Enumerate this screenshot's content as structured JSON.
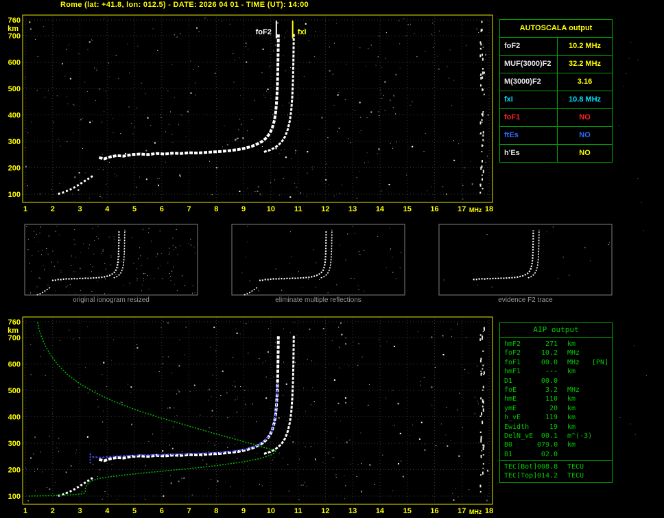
{
  "title": "Rome (lat: +41.8, lon: 012.5) - DATE: 2026 04 01 - TIME (UT): 14:00",
  "colors": {
    "frame": "#e8e800",
    "grid": "#3c3c3c",
    "axis_text": "#ffff00",
    "thumb_border": "#808080",
    "caption_text": "#9a9a9a",
    "table_border": "#00a800",
    "aip_text": "#00cc00",
    "trace_white": "#ffffff",
    "trace_blue": "#4444ff",
    "profile_green": "#00bb00"
  },
  "autoscala": {
    "header": "AUTOSCALA output",
    "rows": [
      {
        "label": "foF2",
        "value": "10.2 MHz",
        "label_color": "#e8e8e8",
        "value_color": "#ffff00"
      },
      {
        "label": "MUF(3000)F2",
        "value": "32.2 MHz",
        "label_color": "#e8e8e8",
        "value_color": "#ffff00"
      },
      {
        "label": "M(3000)F2",
        "value": "3.16",
        "label_color": "#e8e8e8",
        "value_color": "#ffff00"
      },
      {
        "label": "fxI",
        "value": "10.8 MHz",
        "label_color": "#00e0ff",
        "value_color": "#00e0ff"
      },
      {
        "label": "foF1",
        "value": "NO",
        "label_color": "#ff2020",
        "value_color": "#ff2020"
      },
      {
        "label": "ftEs",
        "value": "NO",
        "label_color": "#2f6bff",
        "value_color": "#2f6bff"
      },
      {
        "label": "h'Es",
        "value": "NO",
        "label_color": "#e8e8e8",
        "value_color": "#ffff00"
      }
    ]
  },
  "thumbnails": [
    {
      "caption": "original ionogram resized"
    },
    {
      "caption": "eliminate multiple reflections"
    },
    {
      "caption": "evidence F2 trace"
    }
  ],
  "aip": {
    "header": "AIP output",
    "rows": [
      {
        "name": "hmF2",
        "value": "271",
        "unit": "km",
        "note": ""
      },
      {
        "name": "foF2",
        "value": "10.2",
        "unit": "MHz",
        "note": ""
      },
      {
        "name": "foF1",
        "value": "00.0",
        "unit": "MHz",
        "note": "[PN]"
      },
      {
        "name": "hmF1",
        "value": "---",
        "unit": "km",
        "note": ""
      },
      {
        "name": "D1",
        "value": "00.0",
        "unit": "",
        "note": ""
      },
      {
        "name": "foE",
        "value": "3.2",
        "unit": "MHz",
        "note": ""
      },
      {
        "name": "hmE",
        "value": "110",
        "unit": "km",
        "note": ""
      },
      {
        "name": "ymE",
        "value": "20",
        "unit": "km",
        "note": ""
      },
      {
        "name": "h_vE",
        "value": "119",
        "unit": "km",
        "note": ""
      },
      {
        "name": "Ewidth",
        "value": "19",
        "unit": "km",
        "note": ""
      },
      {
        "name": "DelN_vE",
        "value": "00.1",
        "unit": "m^(-3)",
        "note": ""
      },
      {
        "name": "B0",
        "value": "079.0",
        "unit": "km",
        "note": ""
      },
      {
        "name": "B1",
        "value": "02.0",
        "unit": "",
        "note": ""
      }
    ],
    "tec_rows": [
      {
        "name": "TEC[Bot]",
        "value": "008.8",
        "unit": "TECU"
      },
      {
        "name": "TEC[Top]",
        "value": "014.2",
        "unit": "TECU"
      }
    ]
  },
  "chart_data": [
    {
      "id": "ionogram-top",
      "type": "scatter",
      "title": "recorded ionogram",
      "xlabel": "MHz",
      "ylabel": "km",
      "xlim": [
        1,
        18
      ],
      "ylim": [
        100,
        760
      ],
      "x_ticks": [
        1,
        2,
        3,
        4,
        5,
        6,
        7,
        8,
        9,
        10,
        11,
        12,
        13,
        14,
        15,
        16,
        17,
        18
      ],
      "y_ticks": [
        100,
        200,
        300,
        400,
        500,
        600,
        700,
        760
      ],
      "grid": true,
      "annotations": [
        {
          "label": "foF2",
          "x_mhz": 10.2,
          "color": "#ffffff",
          "label_anchor": "end"
        },
        {
          "label": "fxI",
          "x_mhz": 10.8,
          "color": "#ffff00",
          "label_anchor": "start"
        }
      ],
      "series": [
        {
          "name": "E-region-multiple-trace",
          "color": "#ffffff",
          "width": 3,
          "dash": "3 3",
          "points": [
            [
              2.2,
              101
            ],
            [
              2.35,
              105
            ],
            [
              2.5,
              111
            ],
            [
              2.65,
              118
            ],
            [
              2.8,
              126
            ],
            [
              2.95,
              135
            ],
            [
              3.1,
              145
            ],
            [
              3.25,
              155
            ],
            [
              3.4,
              164
            ],
            [
              3.5,
              172
            ]
          ]
        },
        {
          "name": "F2-O-trace",
          "color": "#ffffff",
          "width": 4,
          "dash": "5 2",
          "points": [
            [
              3.7,
              238
            ],
            [
              3.9,
              234
            ],
            [
              4.1,
              241
            ],
            [
              4.35,
              246
            ],
            [
              4.6,
              244
            ],
            [
              4.9,
              250
            ],
            [
              5.2,
              252
            ],
            [
              5.5,
              250
            ],
            [
              5.8,
              254
            ],
            [
              6.1,
              252
            ],
            [
              6.4,
              255
            ],
            [
              6.7,
              254
            ],
            [
              7.0,
              257
            ],
            [
              7.3,
              256
            ],
            [
              7.6,
              258
            ],
            [
              7.9,
              260
            ],
            [
              8.2,
              262
            ],
            [
              8.5,
              265
            ],
            [
              8.8,
              269
            ],
            [
              9.05,
              274
            ],
            [
              9.3,
              281
            ],
            [
              9.5,
              290
            ],
            [
              9.7,
              301
            ],
            [
              9.85,
              315
            ],
            [
              9.97,
              332
            ],
            [
              10.06,
              354
            ],
            [
              10.13,
              380
            ],
            [
              10.18,
              412
            ],
            [
              10.21,
              450
            ],
            [
              10.235,
              495
            ],
            [
              10.25,
              545
            ],
            [
              10.26,
              600
            ],
            [
              10.27,
              660
            ],
            [
              10.275,
              705
            ]
          ]
        },
        {
          "name": "F2-X-trace",
          "color": "#ffffff",
          "width": 3,
          "dash": "4 2",
          "points": [
            [
              9.75,
              260
            ],
            [
              10.0,
              268
            ],
            [
              10.2,
              280
            ],
            [
              10.38,
              296
            ],
            [
              10.52,
              318
            ],
            [
              10.62,
              345
            ],
            [
              10.7,
              380
            ],
            [
              10.75,
              420
            ],
            [
              10.785,
              470
            ],
            [
              10.81,
              530
            ],
            [
              10.825,
              600
            ],
            [
              10.835,
              670
            ],
            [
              10.84,
              710
            ]
          ]
        }
      ]
    },
    {
      "id": "ionogram-bottom",
      "type": "scatter",
      "title": "autoscaled ionogram with restored trace and electron density profile",
      "xlabel": "MHz",
      "ylabel": "km",
      "xlim": [
        1,
        18
      ],
      "ylim": [
        100,
        760
      ],
      "x_ticks": [
        1,
        2,
        3,
        4,
        5,
        6,
        7,
        8,
        9,
        10,
        11,
        12,
        13,
        14,
        15,
        16,
        17,
        18
      ],
      "y_ticks": [
        100,
        200,
        300,
        400,
        500,
        600,
        700,
        760
      ],
      "grid": true,
      "annotations": [],
      "series": [
        {
          "name": "E-region-multiple-trace",
          "color": "#ffffff",
          "width": 3,
          "dash": "3 3",
          "points": [
            [
              2.2,
              101
            ],
            [
              2.35,
              105
            ],
            [
              2.5,
              111
            ],
            [
              2.65,
              118
            ],
            [
              2.8,
              126
            ],
            [
              2.95,
              135
            ],
            [
              3.1,
              145
            ],
            [
              3.25,
              155
            ],
            [
              3.4,
              164
            ],
            [
              3.5,
              172
            ]
          ]
        },
        {
          "name": "F2-O-trace",
          "color": "#ffffff",
          "width": 4,
          "dash": "5 2",
          "points": [
            [
              3.7,
              238
            ],
            [
              3.9,
              234
            ],
            [
              4.1,
              241
            ],
            [
              4.35,
              246
            ],
            [
              4.6,
              244
            ],
            [
              4.9,
              250
            ],
            [
              5.2,
              252
            ],
            [
              5.5,
              250
            ],
            [
              5.8,
              254
            ],
            [
              6.1,
              252
            ],
            [
              6.4,
              255
            ],
            [
              6.7,
              254
            ],
            [
              7.0,
              257
            ],
            [
              7.3,
              256
            ],
            [
              7.6,
              258
            ],
            [
              7.9,
              260
            ],
            [
              8.2,
              262
            ],
            [
              8.5,
              265
            ],
            [
              8.8,
              269
            ],
            [
              9.05,
              274
            ],
            [
              9.3,
              281
            ],
            [
              9.5,
              290
            ],
            [
              9.7,
              301
            ],
            [
              9.85,
              315
            ],
            [
              9.97,
              332
            ],
            [
              10.06,
              354
            ],
            [
              10.13,
              380
            ],
            [
              10.18,
              412
            ],
            [
              10.21,
              450
            ],
            [
              10.235,
              495
            ],
            [
              10.25,
              545
            ],
            [
              10.26,
              600
            ],
            [
              10.27,
              660
            ],
            [
              10.275,
              705
            ]
          ]
        },
        {
          "name": "F2-X-trace",
          "color": "#ffffff",
          "width": 3,
          "dash": "4 2",
          "points": [
            [
              9.75,
              260
            ],
            [
              10.0,
              268
            ],
            [
              10.2,
              280
            ],
            [
              10.38,
              296
            ],
            [
              10.52,
              318
            ],
            [
              10.62,
              345
            ],
            [
              10.7,
              380
            ],
            [
              10.75,
              420
            ],
            [
              10.785,
              470
            ],
            [
              10.81,
              530
            ],
            [
              10.825,
              600
            ],
            [
              10.835,
              670
            ],
            [
              10.84,
              710
            ]
          ]
        },
        {
          "name": "restored-trace-start-marker",
          "color": "#5555ff",
          "width": 2,
          "dash": "2 2",
          "points": [
            [
              3.38,
              224
            ],
            [
              3.38,
              266
            ]
          ]
        },
        {
          "name": "autoscala-restored-trace",
          "color": "#4444ff",
          "width": 2,
          "dash": "3 2",
          "points": [
            [
              3.45,
              248
            ],
            [
              3.8,
              246
            ],
            [
              4.2,
              250
            ],
            [
              4.7,
              253
            ],
            [
              5.2,
              255
            ],
            [
              5.7,
              256
            ],
            [
              6.2,
              258
            ],
            [
              6.7,
              259
            ],
            [
              7.2,
              261
            ],
            [
              7.7,
              263
            ],
            [
              8.2,
              266
            ],
            [
              8.6,
              270
            ],
            [
              9.0,
              276
            ],
            [
              9.3,
              284
            ],
            [
              9.55,
              294
            ],
            [
              9.75,
              307
            ],
            [
              9.9,
              323
            ],
            [
              10.02,
              344
            ],
            [
              10.1,
              370
            ],
            [
              10.16,
              402
            ],
            [
              10.2,
              440
            ],
            [
              10.23,
              485
            ],
            [
              10.25,
              530
            ]
          ]
        },
        {
          "name": "electron-density-profile",
          "color": "#00bb00",
          "width": 1.5,
          "dash": "2 2",
          "points": [
            [
              1.45,
              758
            ],
            [
              1.5,
              730
            ],
            [
              1.6,
              700
            ],
            [
              1.75,
              665
            ],
            [
              1.95,
              630
            ],
            [
              2.2,
              596
            ],
            [
              2.55,
              560
            ],
            [
              3.0,
              525
            ],
            [
              3.55,
              492
            ],
            [
              4.2,
              460
            ],
            [
              5.0,
              428
            ],
            [
              5.9,
              398
            ],
            [
              6.9,
              368
            ],
            [
              7.9,
              338
            ],
            [
              8.8,
              312
            ],
            [
              9.5,
              292
            ],
            [
              9.95,
              278
            ],
            [
              10.2,
              271
            ],
            [
              10.05,
              257
            ],
            [
              9.6,
              242
            ],
            [
              8.9,
              228
            ],
            [
              8.0,
              215
            ],
            [
              7.0,
              204
            ],
            [
              6.0,
              194
            ],
            [
              5.1,
              185
            ],
            [
              4.3,
              176
            ],
            [
              3.7,
              167
            ],
            [
              3.4,
              156
            ],
            [
              3.25,
              143
            ],
            [
              3.2,
              130
            ],
            [
              3.2,
              119
            ],
            [
              3.18,
              112
            ],
            [
              3.1,
              108
            ],
            [
              2.7,
              105
            ],
            [
              2.1,
              102
            ],
            [
              1.5,
              100.5
            ],
            [
              1.1,
              100
            ]
          ]
        }
      ]
    }
  ]
}
